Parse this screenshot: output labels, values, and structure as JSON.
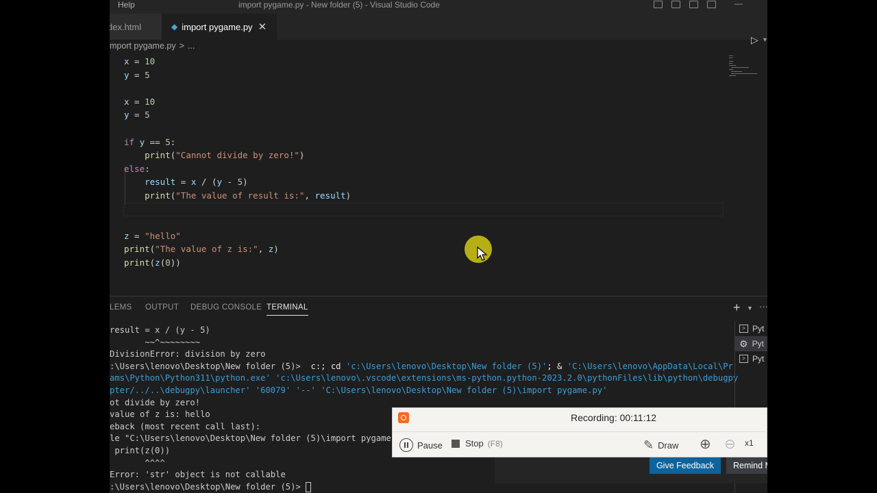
{
  "titlebar": {
    "menu_help": "Help",
    "window_title": "import pygame.py - New folder (5) - Visual Studio Code"
  },
  "tabs": [
    {
      "label": "dex.html",
      "active": false
    },
    {
      "label": "import pygame.py",
      "active": true,
      "close": "✕"
    }
  ],
  "breadcrumb": {
    "file": "mport pygame.py",
    "sep": ">",
    "more": "..."
  },
  "editor": {
    "language_icon": "python-icon",
    "lines": [
      "x = 10",
      "y = 5",
      "",
      "x = 10",
      "y = 5",
      "",
      "if y == 5:",
      "    print(\"Cannot divide by zero!\")",
      "else:",
      "    result = x / (y - 5)",
      "    print(\"The value of result is:\", result)",
      "",
      "",
      "z = \"hello\"",
      "print(\"The value of z is:\", z)",
      "print(z(0))"
    ]
  },
  "panel": {
    "tabs": [
      {
        "label": "LEMS",
        "active": false
      },
      {
        "label": "OUTPUT",
        "active": false
      },
      {
        "label": "DEBUG CONSOLE",
        "active": false
      },
      {
        "label": "TERMINAL",
        "active": true
      }
    ],
    "terminal_lines": [
      "result = x / (y - 5)",
      "       ~~^~~~~~~~~",
      "DivisionError: division by zero",
      ":\\Users\\lenovo\\Desktop\\New folder (5)>  c:; cd 'c:\\Users\\lenovo\\Desktop\\New folder (5)'; & 'C:\\Users\\lenovo\\AppData\\Local\\Pr",
      "ams\\Python\\Python311\\python.exe' 'c:\\Users\\lenovo\\.vscode\\extensions\\ms-python.python-2023.2.0\\pythonFiles\\lib\\python\\debugpy",
      "pter/../..\\debugpy\\launcher' '60079' '--' 'C:\\Users\\lenovo\\Desktop\\New folder (5)\\import pygame.py'",
      "ot divide by zero!",
      "value of z is: hello",
      "eback (most recent call last):",
      "le \"C:\\Users\\lenovo\\Desktop\\New folder (5)\\import pygame.p",
      " print(z(0))",
      "       ^^^^",
      "Error: 'str' object is not callable",
      ":\\Users\\lenovo\\Desktop\\New folder (5)> "
    ],
    "terminal_list": [
      "Pyt",
      "Pyt",
      "Pyt"
    ]
  },
  "recorder": {
    "status": "Recording:  00:11:12",
    "pause_label": "Pause",
    "stop_label": "Stop",
    "stop_key": "(F8)",
    "draw_label": "Draw",
    "zoom_label": "x1"
  },
  "feedback": {
    "give_label": "Give Feedback",
    "remind_label": "Remind M"
  },
  "colors": {
    "accent": "#0e639c",
    "recorder_logo": "#f26b21",
    "cursor_highlight": "#d2c814"
  }
}
